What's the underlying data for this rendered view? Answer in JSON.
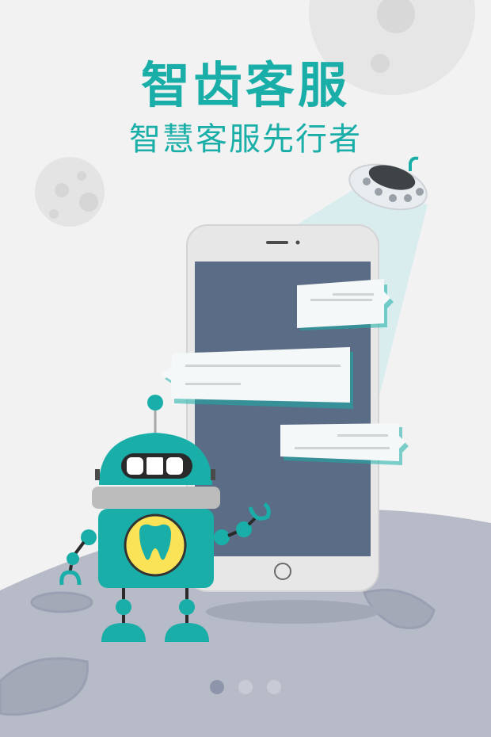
{
  "splash": {
    "title": "智齿客服",
    "subtitle": "智慧客服先行者"
  },
  "illustration": {
    "robot_badge_icon": "tooth-icon",
    "ufo_icon": "ufo-icon",
    "phone_icon": "smartphone-icon"
  },
  "pager": {
    "page_count": 3,
    "active_index": 0
  },
  "colors": {
    "accent": "#1aaea8",
    "background": "#f2f2f2",
    "planet": "#b6bac7",
    "phone_screen": "#5b6c86",
    "badge_yellow": "#fbe358"
  }
}
